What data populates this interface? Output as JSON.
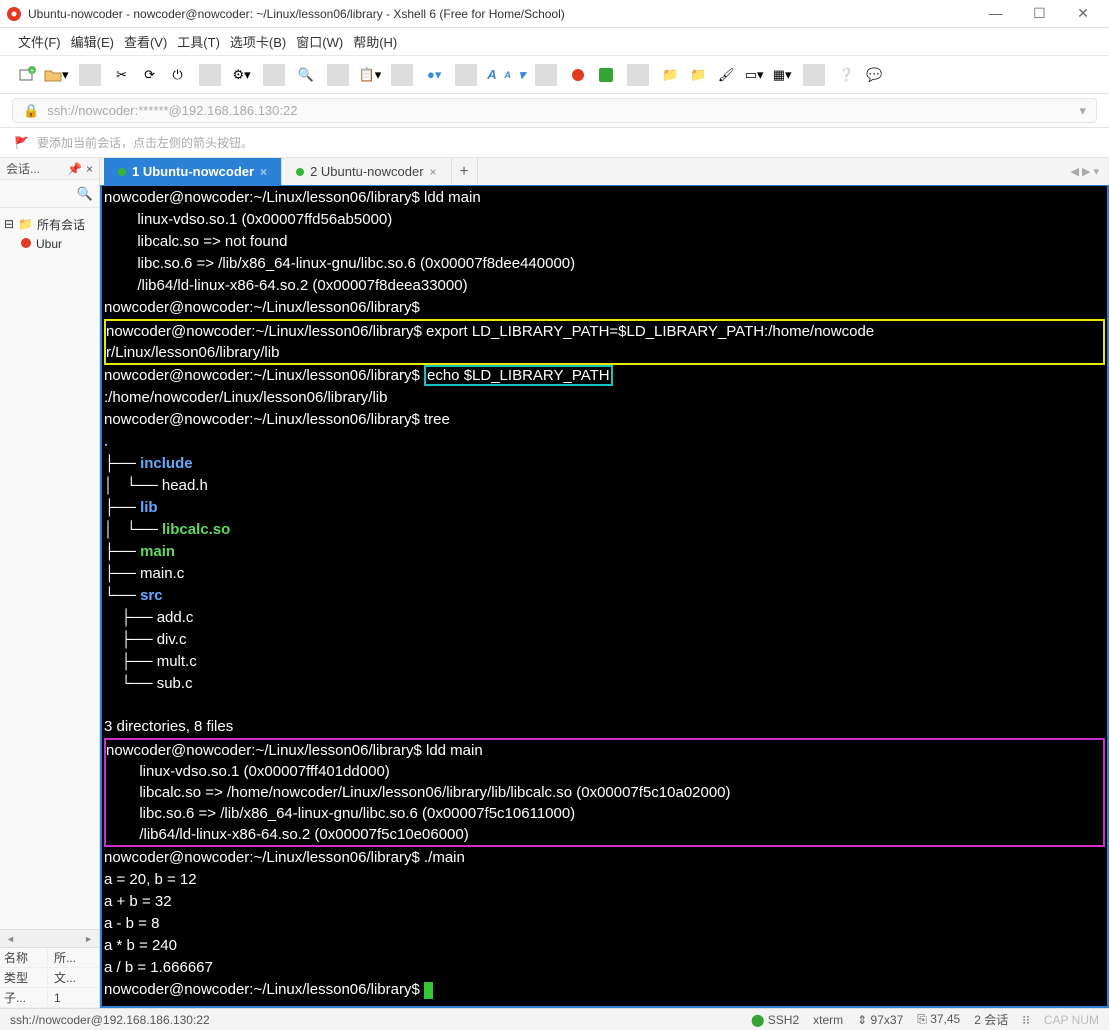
{
  "title": "Ubuntu-nowcoder - nowcoder@nowcoder: ~/Linux/lesson06/library - Xshell 6 (Free for Home/School)",
  "menu": [
    "文件(F)",
    "编辑(E)",
    "查看(V)",
    "工具(T)",
    "选项卡(B)",
    "窗口(W)",
    "帮助(H)"
  ],
  "address": "ssh://nowcoder:******@192.168.186.130:22",
  "hint": "要添加当前会话，点击左侧的箭头按钮。",
  "sidebar": {
    "title": "会话...",
    "root": "所有会话",
    "child": "Ubur",
    "grid": [
      {
        "k": "名称",
        "v": "所..."
      },
      {
        "k": "类型",
        "v": "文..."
      },
      {
        "k": "子...",
        "v": "1"
      }
    ]
  },
  "tabs": [
    {
      "label": "1 Ubuntu-nowcoder",
      "active": true
    },
    {
      "label": "2 Ubuntu-nowcoder",
      "active": false
    }
  ],
  "term": {
    "prompt": "nowcoder@nowcoder:~/Linux/lesson06/library$",
    "cmd1": "ldd main",
    "ldd1": {
      "l1": "        linux-vdso.so.1 (0x00007ffd56ab5000)",
      "l2": "        libcalc.so => not found",
      "l3": "        libc.so.6 => /lib/x86_64-linux-gnu/libc.so.6 (0x00007f8dee440000)",
      "l4": "        /lib64/ld-linux-x86-64.so.2 (0x00007f8deea33000)"
    },
    "export_cmd_line1": "nowcoder@nowcoder:~/Linux/lesson06/library$ export LD_LIBRARY_PATH=$LD_LIBRARY_PATH:/home/nowcode",
    "export_cmd_line2": "r/Linux/lesson06/library/lib",
    "echo_cmd": "echo $LD_LIBRARY_PATH",
    "echo_out": ":/home/nowcoder/Linux/lesson06/library/lib",
    "tree_cmd": "tree",
    "tree": {
      "dot": ".",
      "include": "include",
      "headh": "    └── head.h",
      "lib": "lib",
      "libcalc": "libcalc.so",
      "main": "main",
      "mainc": "├── main.c",
      "src": "src",
      "addc": "    ├── add.c",
      "divc": "    ├── div.c",
      "multc": "    ├── mult.c",
      "subc": "    └── sub.c",
      "summary": "3 directories, 8 files"
    },
    "ldd2": {
      "cmd": "ldd main",
      "l1": "        linux-vdso.so.1 (0x00007fff401dd000)",
      "l2": "        libcalc.so => /home/nowcoder/Linux/lesson06/library/lib/libcalc.so (0x00007f5c10a02000)",
      "l3": "        libc.so.6 => /lib/x86_64-linux-gnu/libc.so.6 (0x00007f5c10611000)",
      "l4": "        /lib64/ld-linux-x86-64.so.2 (0x00007f5c10e06000)"
    },
    "run_cmd": "./main",
    "run_out": {
      "l1": "a = 20, b = 12",
      "l2": "a + b = 32",
      "l3": "a - b = 8",
      "l4": "a * b = 240",
      "l5": "a / b = 1.666667"
    }
  },
  "status": {
    "left": "ssh://nowcoder@192.168.186.130:22",
    "ssh": "SSH2",
    "term": "xterm",
    "size": "97x37",
    "pos": "37,45",
    "sessions": "2 会话",
    "caps": "CAP  NUM"
  }
}
